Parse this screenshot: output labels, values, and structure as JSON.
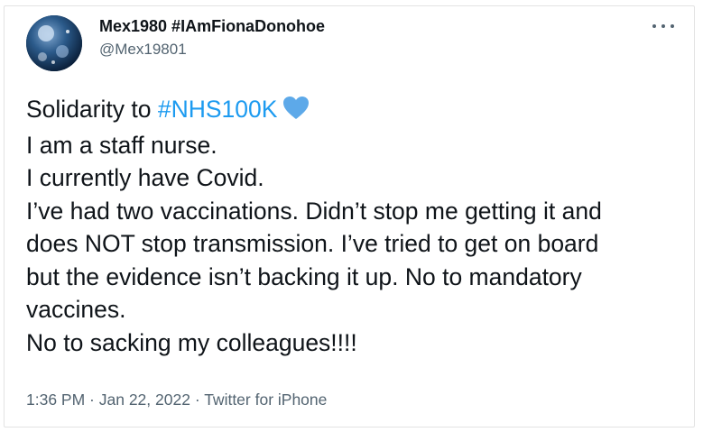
{
  "tweet": {
    "display_name": "Mex1980 #IAmFionaDonohoe",
    "handle": "@Mex19801",
    "more_icon": "more-horizontal-icon",
    "lines": {
      "l1_prefix": "Solidarity to ",
      "l1_hashtag": "#NHS100K",
      "l1_emoji": "blue-heart-icon",
      "l2": "I am a staff nurse.",
      "l3": "I currently have Covid.",
      "l4": "I’ve had two vaccinations. Didn’t stop me getting it and",
      "l5": "does NOT stop transmission. I’ve tried to get on board",
      "l6": "but the evidence isn’t backing it up. No to mandatory",
      "l7": "vaccines.",
      "l8": "No to sacking my colleagues!!!!"
    },
    "time": "1:36 PM",
    "sep": " · ",
    "date": "Jan 22, 2022",
    "source": "Twitter for iPhone"
  },
  "colors": {
    "hashtag": "#1d9bf0",
    "heart": "#5da9e9",
    "text": "#0f1419",
    "secondary": "#536471"
  }
}
